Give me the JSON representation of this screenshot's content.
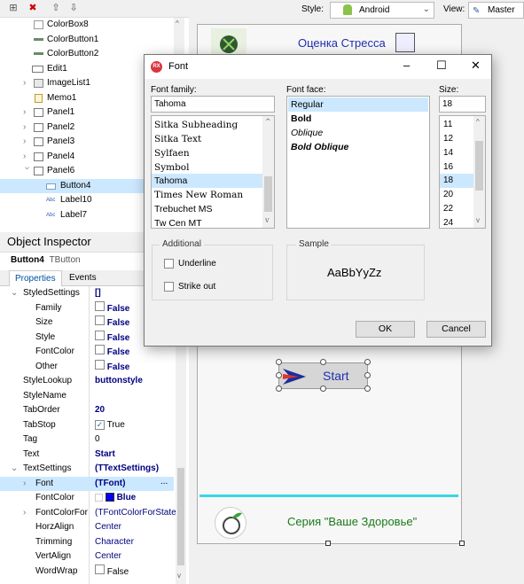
{
  "toolbar": {
    "style_label": "Style:",
    "style_value": "Android",
    "view_label": "View:",
    "view_value": "Master"
  },
  "tree": {
    "items": [
      {
        "label": "ColorBox8"
      },
      {
        "label": "ColorButton1"
      },
      {
        "label": "ColorButton2"
      },
      {
        "label": "Edit1"
      },
      {
        "label": "ImageList1"
      },
      {
        "label": "Memo1"
      },
      {
        "label": "Panel1"
      },
      {
        "label": "Panel2"
      },
      {
        "label": "Panel3"
      },
      {
        "label": "Panel4"
      },
      {
        "label": "Panel6"
      },
      {
        "label": "Button4"
      },
      {
        "label": "Label10"
      },
      {
        "label": "Label7"
      }
    ],
    "icon_badge": "Abc"
  },
  "inspector": {
    "title": "Object Inspector",
    "selected_name": "Button4",
    "selected_type": "TButton",
    "tabs": [
      "Properties",
      "Events"
    ],
    "props": [
      {
        "name": "StyledSettings",
        "value": "[]"
      },
      {
        "name": "Family",
        "value": "False"
      },
      {
        "name": "Size",
        "value": "False"
      },
      {
        "name": "Style",
        "value": "False"
      },
      {
        "name": "FontColor",
        "value": "False"
      },
      {
        "name": "Other",
        "value": "False"
      },
      {
        "name": "StyleLookup",
        "value": "buttonstyle"
      },
      {
        "name": "StyleName",
        "value": ""
      },
      {
        "name": "TabOrder",
        "value": "20"
      },
      {
        "name": "TabStop",
        "value": "True"
      },
      {
        "name": "Tag",
        "value": "0"
      },
      {
        "name": "Text",
        "value": "Start"
      },
      {
        "name": "TextSettings",
        "value": "(TTextSettings)"
      },
      {
        "name": "Font",
        "value": "(TFont)"
      },
      {
        "name": "FontColor",
        "value": "Blue"
      },
      {
        "name": "FontColorFor",
        "value": "(TFontColorForState"
      },
      {
        "name": "HorzAlign",
        "value": "Center"
      },
      {
        "name": "Trimming",
        "value": "Character"
      },
      {
        "name": "VertAlign",
        "value": "Center"
      },
      {
        "name": "WordWrap",
        "value": "False"
      }
    ],
    "font_ellipsis": "..."
  },
  "form": {
    "header_text": "Оценка Стресса",
    "button_text": "Start",
    "footer_text": "Серия \"Ваше Здоровье\""
  },
  "dialog": {
    "icon_text": "RX",
    "title": "Font",
    "minimize": "–",
    "maximize": "☐",
    "close": "✕",
    "family_label": "Font family:",
    "family_value": "Tahoma",
    "families": [
      "Sitka Subheading",
      "Sitka Text",
      "Sylfaen",
      "Symbol",
      "Tahoma",
      "Times New Roman",
      "Trebuchet MS",
      "Tw Cen MT"
    ],
    "face_label": "Font face:",
    "faces": [
      "Regular",
      "Bold",
      "Oblique",
      "Bold Oblique"
    ],
    "size_label": "Size:",
    "size_value": "18",
    "sizes": [
      "11",
      "12",
      "14",
      "16",
      "18",
      "20",
      "22",
      "24"
    ],
    "additional_label": "Additional",
    "underline_label": "Underline",
    "strikeout_label": "Strike out",
    "sample_label": "Sample",
    "sample_text": "AaBbYyZz",
    "ok": "OK",
    "cancel": "Cancel"
  },
  "colors": {
    "accent": "#0078d7",
    "selection": "#cce8ff",
    "title_blue": "#1f2fb0",
    "footer_green": "#1a7a1a",
    "inspector_value": "#00007f",
    "cyan_line": "#39d5e6"
  }
}
